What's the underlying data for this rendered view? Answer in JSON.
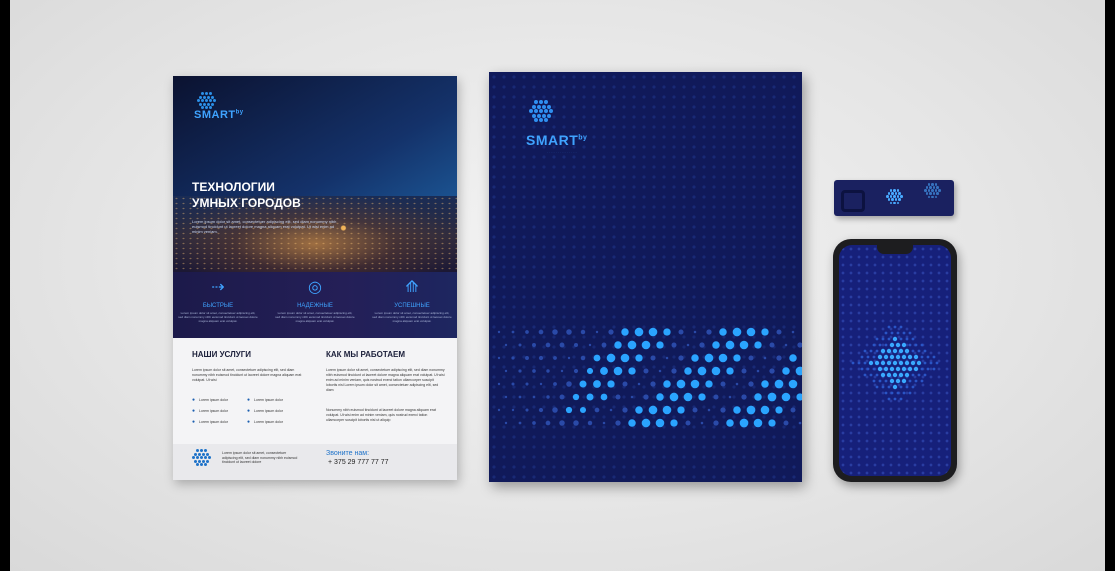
{
  "flyer": {
    "brand": "SMART",
    "brand_sup": "by",
    "title_line1": "ТЕХНОЛОГИИ",
    "title_line2": "УМНЫХ ГОРОДОВ",
    "intro": "Lorem ipsum dolor sit amet, consectetuer adipiscing elit, sed diam nonummy nibh euismod tincidunt ut laoreet dolore magna aliquam erat volutpat. Ut wisi enim ad minim veniam.",
    "features": [
      {
        "icon": "arrow-icon",
        "label": "БЫСТРЫЕ",
        "text": "Lorem ipsum dolor sit amet, consectetuer adipiscing elit, sed diam nonummy nibh euismod tincidunt ut laoreet dolore magna aliquam erat volutpat."
      },
      {
        "icon": "target-icon",
        "label": "НАДЕЖНЫЕ",
        "text": "Lorem ipsum dolor sit amet, consectetuer adipiscing elit, sed diam nonummy nibh euismod tincidunt ut laoreet dolore magna aliquam erat volutpat."
      },
      {
        "icon": "pyramid-icon",
        "label": "УСПЕШНЫЕ",
        "text": "Lorem ipsum dolor sit amet, consectetuer adipiscing elit, sed diam nonummy nibh euismod tincidunt ut laoreet dolore magna aliquam erat volutpat."
      }
    ],
    "services_heading": "НАШИ УСЛУГИ",
    "services_text": "Lorem ipsum dolor sit amet, consectetuer adipiscing elit, sed diam nonummy nibh euismod tincidunt ut laoreet dolore magna aliquam erat volutpat. Ut wisi",
    "services_items": [
      "Lorem ipsum dolor",
      "Lorem ipsum dolor",
      "Lorem ipsum dolor",
      "Lorem ipsum dolor",
      "Lorem ipsum dolor",
      "Lorem ipsum dolor"
    ],
    "how_heading": "КАК МЫ РАБОТАЕМ",
    "how_text1": "Lorem ipsum dolor sit amet, consectetuer adipiscing elit, sed diam nonummy nibh euismod tincidunt ut laoreet dolore magna aliquam erat volutpat. Ut wisi enim ad minim veniam, quis nostrud exerci tation ullamcorper suscipit lobortis nisl Lorem ipsum dolor sit amet, consectetuer adipiscing elit, sed diam",
    "how_text2": "Nonummy nibh euismod tincidunt ut laoreet dolore magna aliquam erat volutpat. Ut wisi enim ad minim veniam, quis nostrud exerci tation ullamcorper suscipit lobortis nisl ut aliquip",
    "footer_text": "Lorem ipsum dolor sit amet, consectetuer adipiscing elit, sed diam nonummy nibh euismod tincidunt ut laoreet dolore",
    "call_label": "Звоните нам:",
    "phone": "+ 375 29 777 77 77"
  },
  "folder": {
    "brand": "SMART",
    "brand_sup": "by"
  },
  "colors": {
    "navy": "#101a5a",
    "accent": "#3fa3ff",
    "background": "#e6e6e6"
  }
}
